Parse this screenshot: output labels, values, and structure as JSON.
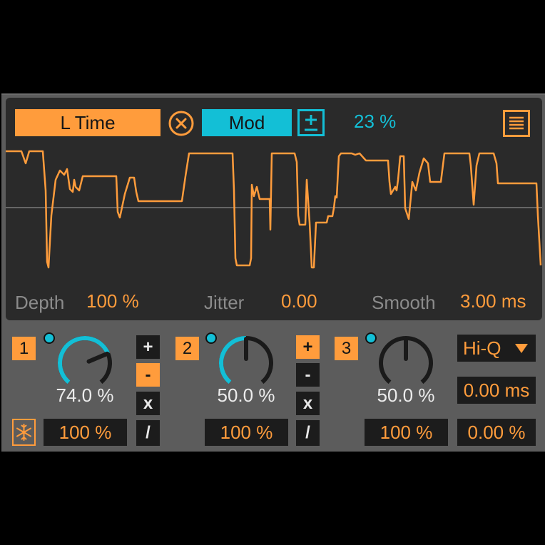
{
  "header": {
    "source_label": "L Time",
    "mod_label": "Mod",
    "amount": "23 %"
  },
  "controls": {
    "depth_label": "Depth",
    "depth_value": "100 %",
    "jitter_label": "Jitter",
    "jitter_value": "0.00",
    "smooth_label": "Smooth",
    "smooth_value": "3.00 ms"
  },
  "slots": [
    {
      "number": "1",
      "knob_value": "74.0 %",
      "knob_level": 0.74,
      "amount": "100 %"
    },
    {
      "number": "2",
      "knob_value": "50.0 %",
      "knob_level": 0.5,
      "amount": "100 %"
    },
    {
      "number": "3",
      "knob_value": "50.0 %",
      "knob_level": 0.5,
      "amount": "100 %"
    }
  ],
  "ops": {
    "plus": "+",
    "minus": "-",
    "times": "x",
    "divide": "/"
  },
  "right_panel": {
    "quality": "Hi-Q",
    "time_value": "0.00 ms",
    "percent_value": "0.00 %"
  },
  "colors": {
    "accent_orange": "#ff9c3c",
    "accent_cyan": "#13bfd6",
    "panel_grey": "#5c5c5c",
    "display_bg": "#2a2a2a"
  },
  "icons": {
    "clear": "close-circle-icon",
    "bipolar": "plus-minus-icon",
    "menu": "list-icon",
    "freeze": "snowflake-icon",
    "dropdown": "triangle-down-icon"
  }
}
